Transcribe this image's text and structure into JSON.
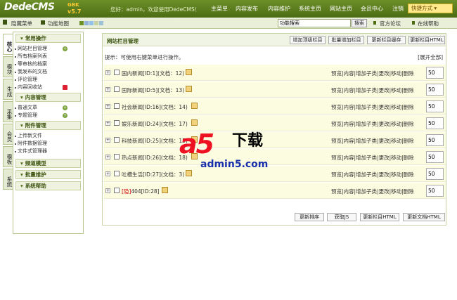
{
  "brand": {
    "logo": "DedeCMS",
    "ver_top": "GBK",
    "ver": "v5.7"
  },
  "header": {
    "welcome": "您好：admin，欢迎使用DedeCMS！",
    "nav": [
      "主菜单",
      "内容发布",
      "内容维护",
      "系统主页",
      "网站主页",
      "会员中心",
      "注销"
    ],
    "quick": "快捷方式 ▾"
  },
  "subbar": {
    "hide_menu": "隐藏菜单",
    "sitemap": "功能地图",
    "search_placeholder": "功能搜索",
    "search_btn": "搜索",
    "forum": "官方论坛",
    "help": "在线帮助",
    "square_colors": [
      "#6d8f28",
      "#8fb1d8",
      "#93c2e8",
      "#c7d3a6",
      "#9cc3d5"
    ]
  },
  "vtabs": [
    "核心",
    "模块",
    "生成",
    "采集",
    "会员",
    "模板",
    "系统"
  ],
  "sidebar": {
    "sections": [
      {
        "title": "常用操作",
        "items": [
          "网站栏目管理",
          "所有档案列表",
          "等审核的档案",
          "我发布的文档",
          "评论管理",
          "内容回收站"
        ]
      },
      {
        "title": "内容管理",
        "items": [
          "普通文章",
          "专题管理"
        ]
      },
      {
        "title": "附件管理",
        "items": [
          "上传新文件",
          "附件数据管理",
          "文件式管理器"
        ]
      },
      {
        "title": "频道模型",
        "items": []
      },
      {
        "title": "批量维护",
        "items": []
      },
      {
        "title": "系统帮助",
        "items": []
      }
    ]
  },
  "main": {
    "title": "网站栏目管理",
    "buttons": [
      "增加顶级栏目",
      "批量增加栏目",
      "更新栏目缓存",
      "更新栏目HTML"
    ],
    "tip": "提示：可使用右键菜单进行操作。",
    "expand": "[展开全部]",
    "rows": [
      {
        "name": "国内新闻[ID:1](文档：12)",
        "order": "50"
      },
      {
        "name": "国际新闻[ID:5](文档：13)",
        "order": "50"
      },
      {
        "name": "社会新闻[ID:16](文档：14)",
        "order": "50"
      },
      {
        "name": "娱乐新闻[ID:24](文档：17)",
        "order": "50"
      },
      {
        "name": "科技新闻[ID:25](文档：15)",
        "order": "50"
      },
      {
        "name": "热点新闻[ID:26](文档：18)",
        "order": "50"
      },
      {
        "name": "吐槽生活[ID:27](文档：3)",
        "order": "50"
      },
      {
        "name_red": "[隐]",
        "name": "404[ID:28]",
        "order": "50"
      }
    ],
    "ops": "预览|内容|增加子类|更改|移动|删除",
    "footer_buttons": [
      "更新排序",
      "获取JS",
      "更新栏目HTML",
      "更新文档HTML"
    ]
  },
  "watermark": {
    "logo": "a5",
    "text": "下载",
    "url": "admin5.com"
  }
}
